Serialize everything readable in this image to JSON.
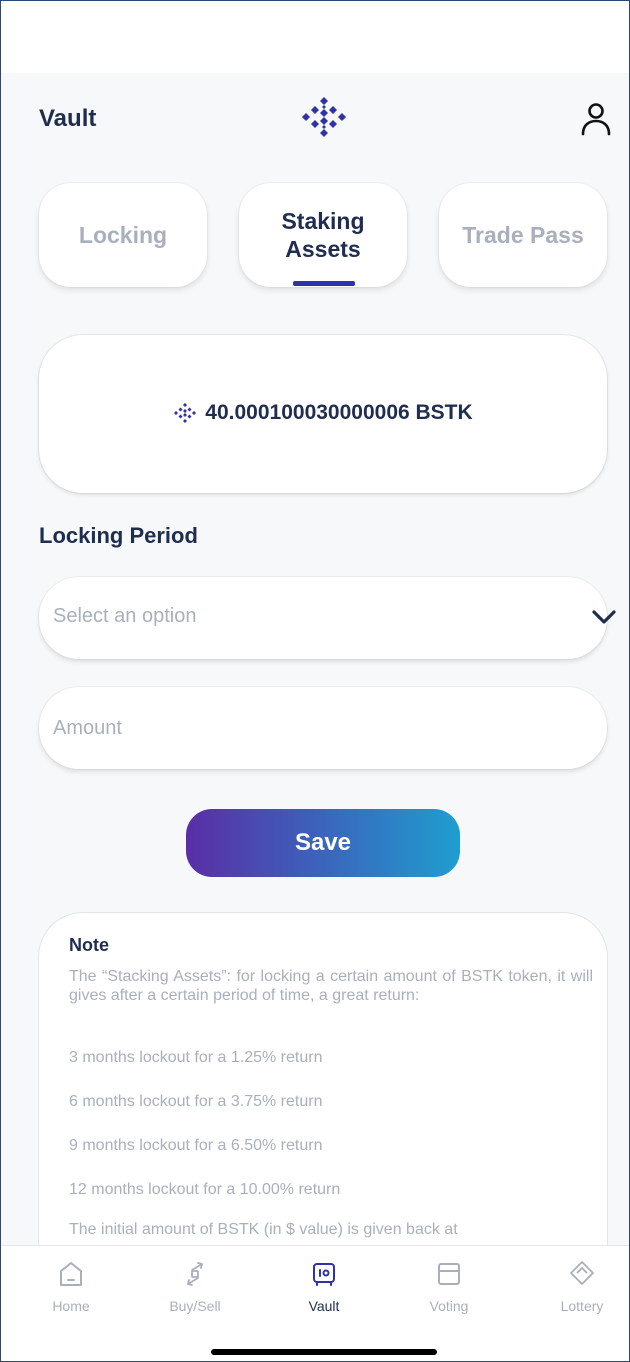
{
  "header": {
    "title": "Vault",
    "logo_icon": "bstk-logo-icon",
    "profile_icon": "user-profile-icon"
  },
  "tabs": [
    {
      "label": "Locking",
      "active": false
    },
    {
      "label": "Staking\nAssets",
      "active": true
    },
    {
      "label": "Trade Pass",
      "active": false
    }
  ],
  "balance": {
    "icon": "bstk-logo-icon",
    "text": "40.000100030000006 BSTK"
  },
  "form": {
    "period_label": "Locking Period",
    "period_select": {
      "placeholder": "Select an option",
      "icon": "chevron-down-icon"
    },
    "amount_input": {
      "value": "",
      "placeholder": "Amount"
    },
    "save_label": "Save"
  },
  "note": {
    "title": "Note",
    "intro": "The “Stacking Assets”: for locking a certain amount of BSTK token, it will gives after a certain period of time, a great return:",
    "lines": [
      "3 months lockout for a 1.25% return",
      "6 months lockout for a 3.75% return",
      "9 months lockout for a 6.50% return",
      "12 months lockout for a 10.00% return"
    ],
    "footer": "The initial amount of BSTK (in $ value) is given back at"
  },
  "nav": [
    {
      "label": "Home",
      "icon": "home-icon",
      "active": false
    },
    {
      "label": "Buy/Sell",
      "icon": "exchange-arrows-icon",
      "active": false
    },
    {
      "label": "Vault",
      "icon": "vault-icon",
      "active": true
    },
    {
      "label": "Voting",
      "icon": "voting-box-icon",
      "active": false
    },
    {
      "label": "Lottery",
      "icon": "lottery-ticket-icon",
      "active": false
    }
  ],
  "colors": {
    "primary_text": "#1f2d4f",
    "muted_text": "#a9b0bc",
    "brand_blue": "#2f33a8",
    "gradient_start": "#5a2ea6",
    "gradient_end": "#1f9ed0"
  }
}
